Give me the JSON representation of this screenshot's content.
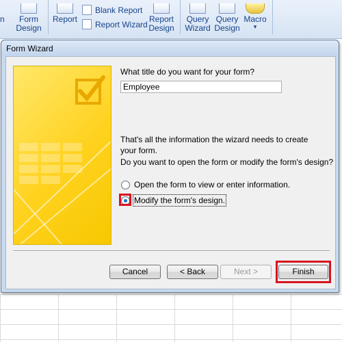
{
  "ribbon": {
    "partial_left": "n",
    "form_design": [
      "Form",
      "Design"
    ],
    "report": "Report",
    "blank_report": "Blank Report",
    "report_wizard": "Report Wizard",
    "report_design": [
      "Report",
      "Design"
    ],
    "query_wizard": [
      "Query",
      "Wizard"
    ],
    "query_design": [
      "Query",
      "Design"
    ],
    "macro": "Macro",
    "macro_arrow": "▾"
  },
  "dialog": {
    "title": "Form Wizard",
    "question_title": "What title do you want for your form?",
    "title_value": "Employee",
    "info": "That's all the information the wizard needs to create your form.",
    "question_action": "Do you want to open the form or modify the form's design?",
    "options": [
      {
        "label": "Open the form to view or enter information.",
        "checked": false
      },
      {
        "label": "Modify the form's design.",
        "checked": true
      }
    ],
    "buttons": {
      "cancel": "Cancel",
      "back": "< Back",
      "next": "Next >",
      "finish": "Finish"
    }
  },
  "colors": {
    "highlight": "#d7141f",
    "art_yellow": "#ffd21f",
    "dialog_frame": "#c7d9ee"
  }
}
